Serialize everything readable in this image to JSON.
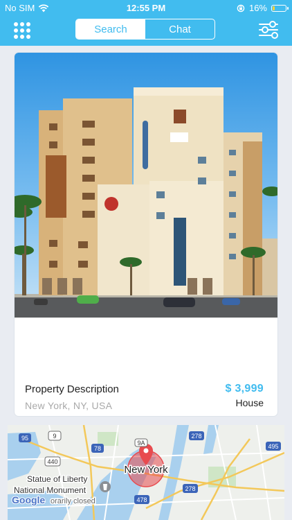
{
  "status_bar": {
    "carrier": "No SIM",
    "time": "12:55 PM",
    "battery": "16%",
    "battery_level": 0.16
  },
  "header": {
    "menu_icon": "grid-menu-icon",
    "tabs": [
      {
        "label": "Search",
        "active": true
      },
      {
        "label": "Chat",
        "active": false
      }
    ],
    "filter_icon": "sliders-icon"
  },
  "property": {
    "title": "Property Description",
    "location": "New York, NY, USA",
    "price": "$ 3,999",
    "type": "House"
  },
  "map": {
    "city_label": "New York",
    "poi_label_line1": "Statue of Liberty",
    "poi_label_line2": "National Monument",
    "poi_status": "orarily closed",
    "google_logo": "Google",
    "route_shields": [
      "95",
      "9",
      "440",
      "78",
      "9A",
      "278",
      "495",
      "478",
      "278"
    ]
  },
  "colors": {
    "accent": "#41bcef",
    "pin": "#e84b4f",
    "highway": "#f3c85a"
  }
}
